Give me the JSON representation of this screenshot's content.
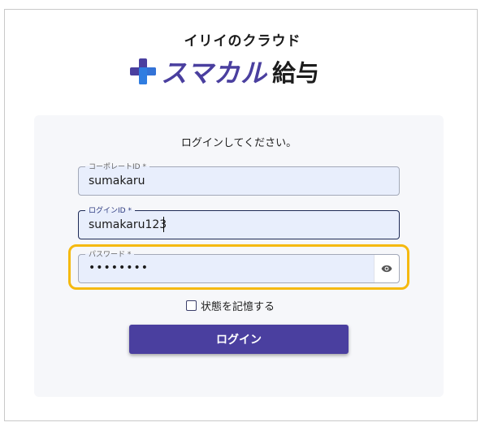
{
  "brand": {
    "company": "イリイのクラウド",
    "product_name": "スマカル",
    "product_suffix": "給与",
    "accent_color": "#4a3f9f",
    "plus_colors": [
      "#4a3f9f",
      "#2f7de1"
    ]
  },
  "login": {
    "prompt": "ログインしてください。",
    "corporate_id": {
      "label": "コーポレートID *",
      "value": "sumakaru"
    },
    "login_id": {
      "label": "ログインID *",
      "value": "sumakaru123"
    },
    "password": {
      "label": "パスワード *",
      "value": "••••••••",
      "toggle_icon": "eye-icon"
    },
    "remember_label": "状態を記憶する",
    "remember_checked": false,
    "submit_label": "ログイン"
  },
  "highlight_color": "#f5b90f"
}
